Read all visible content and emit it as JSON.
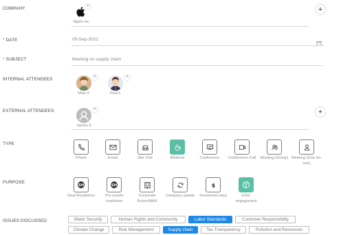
{
  "fields": {
    "company": {
      "label": "COMPANY",
      "value": "Apple Inc"
    },
    "date": {
      "label": "DATE",
      "value": "05-Sep-2022"
    },
    "subject": {
      "label": "SUBJECT",
      "value": "Meeting on supply chain"
    },
    "internal_attendees": {
      "label": "INTERNAL ATTENDEES",
      "people": [
        {
          "name": "Mais C"
        },
        {
          "name": "Paul L"
        }
      ]
    },
    "external_attendees": {
      "label": "EXTERNAL ATTENDEES",
      "people": [
        {
          "name": "James S"
        }
      ]
    },
    "type": {
      "label": "TYPE",
      "options": [
        {
          "label": "Phone",
          "icon": "phone-icon",
          "selected": false
        },
        {
          "label": "Email",
          "icon": "email-icon",
          "selected": false
        },
        {
          "label": "Site Visit",
          "icon": "car-icon",
          "selected": false
        },
        {
          "label": "Webinar",
          "icon": "coffee-icon",
          "selected": true
        },
        {
          "label": "Conference",
          "icon": "presentation-icon",
          "selected": false
        },
        {
          "label": "Conference Call",
          "icon": "video-icon",
          "selected": false
        },
        {
          "label": "Meeting (Group)",
          "icon": "group-icon",
          "selected": false
        },
        {
          "label": "Meeting (One-on-one)",
          "icon": "person-icon",
          "selected": false
        }
      ]
    },
    "purpose": {
      "label": "PURPOSE",
      "options": [
        {
          "label": "Deal Roadshow",
          "icon": "roadshow-icon",
          "selected": false
        },
        {
          "label": "Pre-results roadshow",
          "icon": "roadshow-icon",
          "selected": false
        },
        {
          "label": "Corporate Action/M&A",
          "icon": "building-icon",
          "selected": false
        },
        {
          "label": "Company update",
          "icon": "refresh-icon",
          "selected": false
        },
        {
          "label": "Investment idea",
          "icon": "dollar-icon",
          "selected": false
        },
        {
          "label": "ESG engagement",
          "icon": "globe-icon",
          "selected": true
        }
      ]
    },
    "issues": {
      "label": "ISSUES DISCUSSED",
      "tags": [
        {
          "label": "Water Security",
          "selected": false
        },
        {
          "label": "Human Rights and Community",
          "selected": false
        },
        {
          "label": "Labor Standards",
          "selected": true
        },
        {
          "label": "Customer Responsibility",
          "selected": false
        },
        {
          "label": "Climate Change",
          "selected": false
        },
        {
          "label": "Risk Management",
          "selected": false
        },
        {
          "label": "Supply chain",
          "selected": true
        },
        {
          "label": "Tax Transparency",
          "selected": false
        },
        {
          "label": "Pollution and Resources",
          "selected": false
        }
      ]
    }
  },
  "colors": {
    "accent_green": "#5bbfa5",
    "accent_blue": "#1e88e5",
    "required": "#e2403c"
  }
}
